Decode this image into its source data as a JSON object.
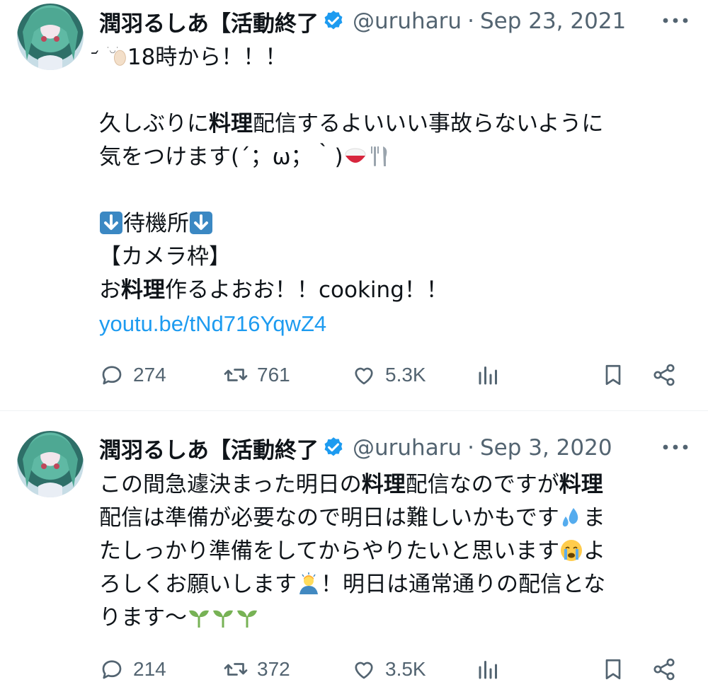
{
  "tweets": [
    {
      "display_name": "潤羽るしあ【活動終了",
      "handle": "@uruharu",
      "separator": "·",
      "date": "Sep 23, 2021",
      "lines": {
        "l1_text": "18時から！！！",
        "l2_a": "久しぶりに",
        "l2_b": "料理",
        "l2_c": "配信するよいいい事故らないように",
        "l3": "気をつけます(´；ω；｀)",
        "l4": "待機所",
        "l5": "【カメラ枠】",
        "l6_a": "お",
        "l6_b": "料理",
        "l6_c": "作るよおお！！cooking！！",
        "link": "youtu.be/tNd716YqwZ4"
      },
      "stats": {
        "replies": "274",
        "retweets": "761",
        "likes": "5.3K"
      }
    },
    {
      "display_name": "潤羽るしあ【活動終了",
      "handle": "@uruharu",
      "separator": "·",
      "date": "Sep 3, 2020",
      "lines": {
        "l1_a": "この間急遽決まった明日の",
        "l1_b": "料理",
        "l1_c": "配信なのですが",
        "l1_d": "料理",
        "l2_a": "配信は準備が必要なので明日は難しいかもです",
        "l2_b": "ま",
        "l3_a": "たしっかり準備をしてからやりたいと思います",
        "l3_b": "よ",
        "l4_a": "ろしくお願いします",
        "l4_b": "！明日は通常通りの配信とな",
        "l5": "ります〜"
      },
      "stats": {
        "replies": "214",
        "retweets": "372",
        "likes": "3.5K"
      }
    }
  ],
  "icons": [
    "verified-badge-icon",
    "more-icon",
    "reply-icon",
    "retweet-icon",
    "like-icon",
    "views-icon",
    "bookmark-icon",
    "share-icon"
  ],
  "colors": {
    "text": "#0f1419",
    "secondary": "#536471",
    "link": "#1d9bf0",
    "verified": "#1d9bf0",
    "divider": "#eff3f4"
  }
}
